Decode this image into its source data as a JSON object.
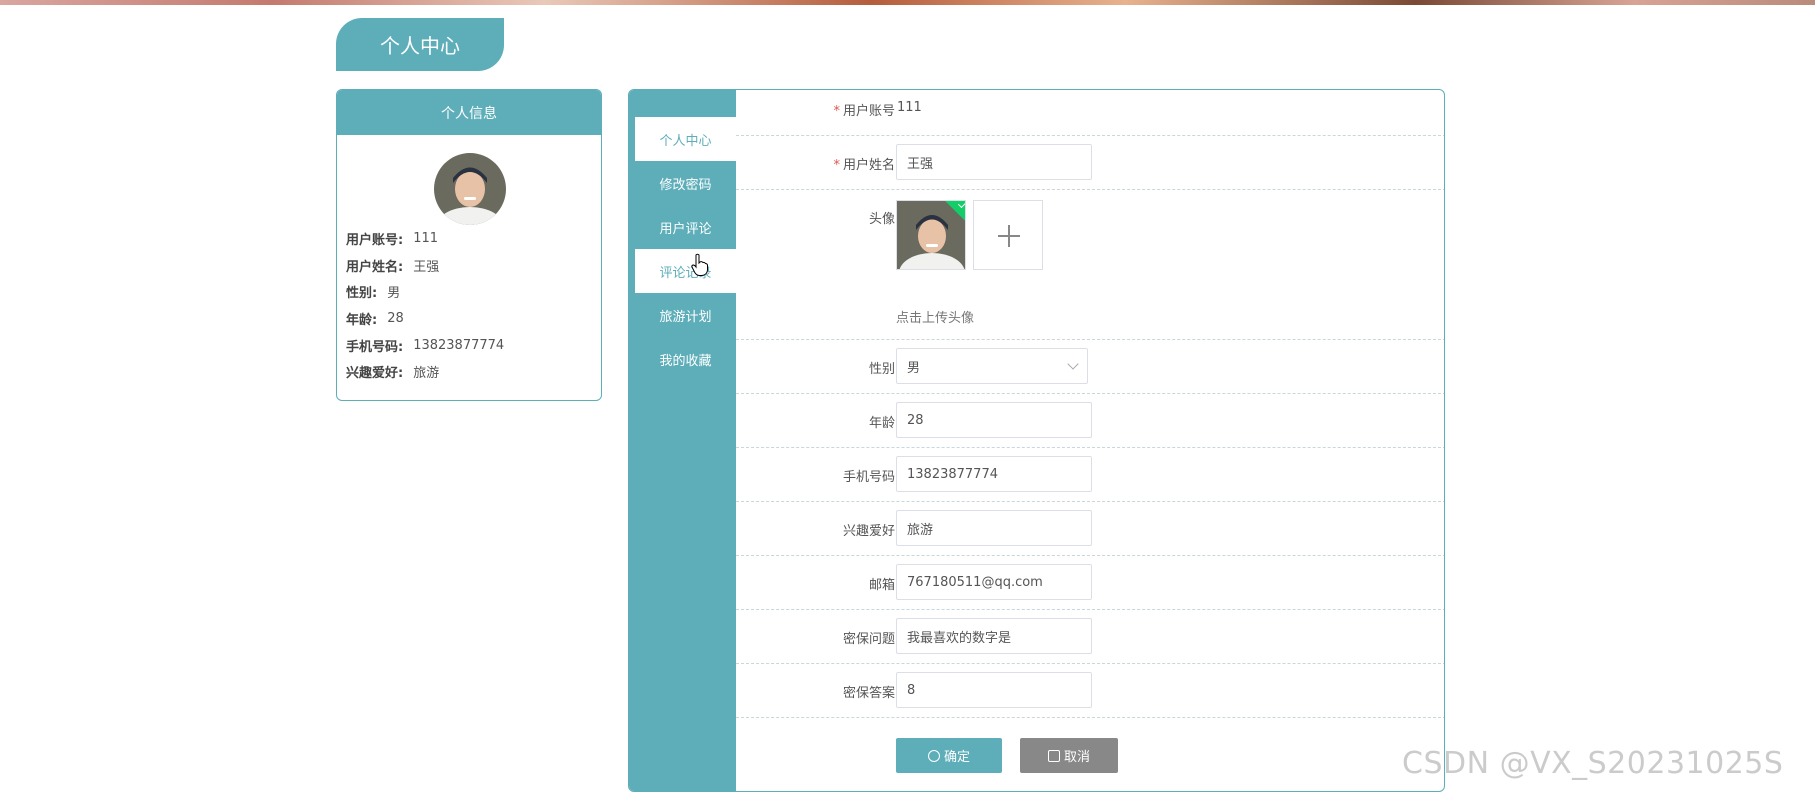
{
  "page_title": "个人中心",
  "profile_card": {
    "header": "个人信息",
    "rows": [
      {
        "label": "用户账号:",
        "value": "111"
      },
      {
        "label": "用户姓名:",
        "value": "王强"
      },
      {
        "label": "性别:",
        "value": "男"
      },
      {
        "label": "年龄:",
        "value": "28"
      },
      {
        "label": "手机号码:",
        "value": "13823877774"
      },
      {
        "label": "兴趣爱好:",
        "value": "旅游"
      }
    ]
  },
  "side_nav": {
    "items": [
      {
        "label": "个人中心",
        "active": true
      },
      {
        "label": "修改密码",
        "active": false
      },
      {
        "label": "用户评论",
        "active": false
      },
      {
        "label": "评论记录",
        "active": false
      },
      {
        "label": "旅游计划",
        "active": false
      },
      {
        "label": "我的收藏",
        "active": false
      }
    ]
  },
  "form": {
    "account": {
      "label": "用户账号",
      "value": "111"
    },
    "name": {
      "label": "用户姓名",
      "value": "王强"
    },
    "avatar": {
      "label": "头像",
      "hint": "点击上传头像"
    },
    "gender": {
      "label": "性别",
      "value": "男"
    },
    "age": {
      "label": "年龄",
      "value": "28"
    },
    "phone": {
      "label": "手机号码",
      "value": "13823877774"
    },
    "hobby": {
      "label": "兴趣爱好",
      "value": "旅游"
    },
    "email": {
      "label": "邮箱",
      "value": "767180511@qq.com"
    },
    "security_question": {
      "label": "密保问题",
      "value": "我最喜欢的数字是"
    },
    "security_answer": {
      "label": "密保答案",
      "value": "8"
    },
    "required_mark": "*"
  },
  "buttons": {
    "confirm": "确定",
    "cancel": "取消"
  },
  "watermark": "CSDN @VX_S20231025S",
  "colors": {
    "accent": "#5eaeba",
    "cancel": "#888888",
    "required": "#e5534b",
    "upload_ok": "#13ce66"
  }
}
